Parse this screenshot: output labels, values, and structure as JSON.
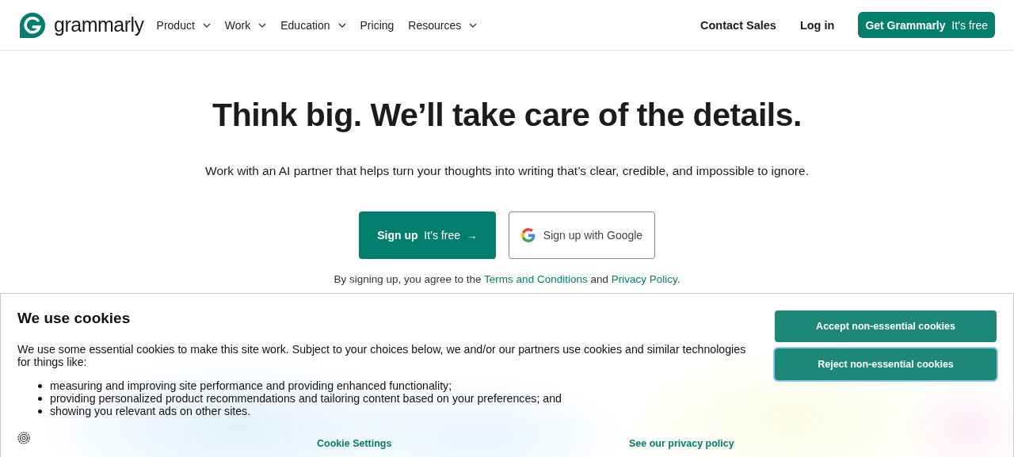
{
  "header": {
    "logo_text": "grammarly",
    "nav": [
      {
        "label": "Product",
        "has_menu": true
      },
      {
        "label": "Work",
        "has_menu": true
      },
      {
        "label": "Education",
        "has_menu": true
      },
      {
        "label": "Pricing",
        "has_menu": false
      },
      {
        "label": "Resources",
        "has_menu": true
      }
    ],
    "contact": "Contact Sales",
    "login": "Log in",
    "cta": {
      "label": "Get Grammarly",
      "note": "It’s free"
    }
  },
  "hero": {
    "title": "Think big. We’ll take care of the details.",
    "subtitle": "Work with an AI partner that helps turn your thoughts into writing that’s clear, credible, and impossible to ignore.",
    "signup": {
      "label": "Sign up",
      "note": "It’s free",
      "arrow": "→"
    },
    "google": "Sign up with Google",
    "agreement": {
      "before": "By signing up, you agree to the ",
      "terms": "Terms and Conditions",
      "middle": " and ",
      "privacy": "Privacy Policy",
      "after": "."
    }
  },
  "cookies": {
    "title": "We use cookies",
    "text": "We use some essential cookies to make this site work. Subject to your choices below, we and/or our partners use cookies and similar technologies for things like:",
    "items": [
      "measuring and improving site performance and providing enhanced functionality;",
      "providing personalized product recommendations and tailoring content based on your preferences; and",
      "showing you relevant ads on other sites."
    ],
    "buttons": [
      {
        "label": "Accept non-essential cookies",
        "focused": false
      },
      {
        "label": "Reject non-essential cookies",
        "focused": true
      }
    ],
    "settings": "Cookie Settings",
    "policy": "See our privacy policy"
  }
}
